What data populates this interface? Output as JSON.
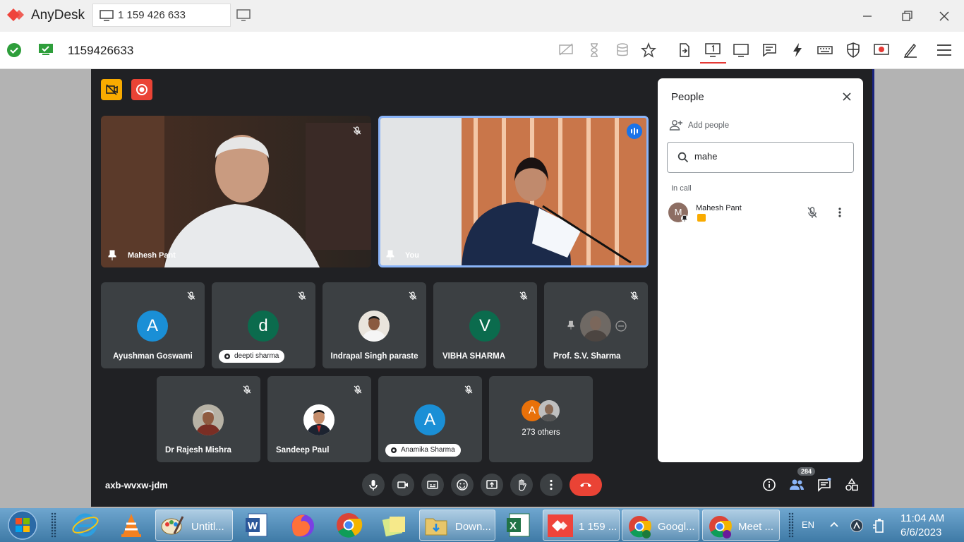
{
  "anydesk": {
    "app_name": "AnyDesk",
    "session_tab": "1 159 426 633",
    "address_id": "1159426633"
  },
  "meet": {
    "meeting_code": "axb-wvxw-jdm",
    "featured": [
      {
        "name": "Mahesh Pant"
      },
      {
        "name": "You"
      }
    ],
    "tiles": [
      {
        "name": "Ayushman Goswami",
        "initial": "A",
        "color": "#1a8fd6"
      },
      {
        "pill": "deepti sharma",
        "initial": "d",
        "color": "#0b6b4d"
      },
      {
        "name": "Indrapal Singh paraste"
      },
      {
        "name": "VIBHA SHARMA",
        "initial": "V",
        "color": "#0b6b4d"
      },
      {
        "name": "Prof. S.V. Sharma"
      },
      {
        "name": "Dr Rajesh Mishra"
      },
      {
        "name": "Sandeep Paul"
      },
      {
        "pill": "Anamika Sharma",
        "initial": "A",
        "color": "#1a8fd6"
      },
      {
        "name": "273 others",
        "initial": "A",
        "color": "#e8710a"
      }
    ],
    "people_count": "284",
    "end_call_color": "#ea4335"
  },
  "people_panel": {
    "title": "People",
    "add_people": "Add people",
    "search_value": "mahe",
    "in_call": "In call",
    "participant": {
      "name": "Mahesh Pant",
      "initial": "M"
    }
  },
  "taskbar": {
    "apps": [
      {
        "label": "Untitl..."
      },
      {
        "label": "Down..."
      },
      {
        "label": "1 159 ..."
      },
      {
        "label": "Googl..."
      },
      {
        "label": "Meet ..."
      }
    ],
    "lang": "EN",
    "time": "11:04 AM",
    "date": "6/6/2023"
  }
}
